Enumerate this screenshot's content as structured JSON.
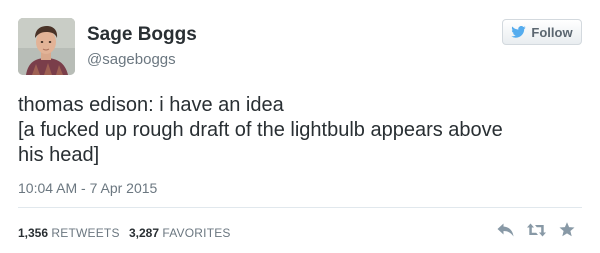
{
  "user": {
    "display_name": "Sage Boggs",
    "screen_name": "@sageboggs",
    "avatar_icon": "profile-photo"
  },
  "follow_button": {
    "label": "Follow",
    "icon": "twitter-bird-icon"
  },
  "tweet": {
    "lines": [
      "thomas edison: i have an idea",
      "[a fucked up rough draft of the lightbulb appears above",
      "his head]"
    ],
    "timestamp": "10:04 AM - 7 Apr 2015"
  },
  "stats": {
    "retweets": {
      "count": "1,356",
      "label": "RETWEETS"
    },
    "favorites": {
      "count": "3,287",
      "label": "FAVORITES"
    }
  },
  "actions": [
    "reply-icon",
    "retweet-icon",
    "favorite-icon"
  ],
  "colors": {
    "text": "#292f33",
    "muted": "#6b7780",
    "icon": "#8899a6",
    "divider": "#e1e8ed",
    "twitter_blue": "#55acee"
  }
}
